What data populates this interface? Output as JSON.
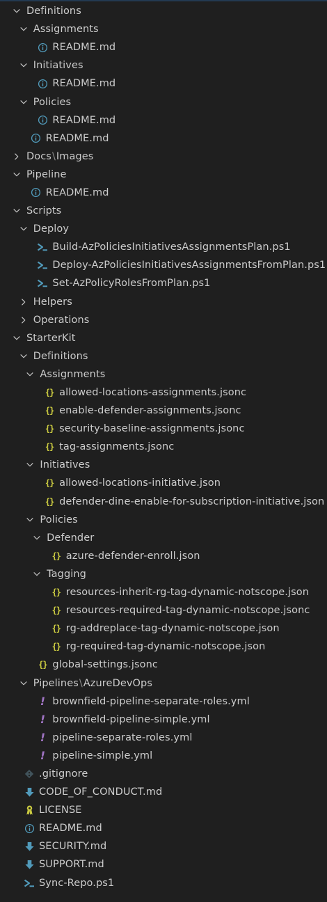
{
  "tree": [
    {
      "type": "folder",
      "depth": 0,
      "expanded": true,
      "label": "Definitions"
    },
    {
      "type": "folder",
      "depth": 1,
      "expanded": true,
      "label": "Assignments"
    },
    {
      "type": "file",
      "depth": 2,
      "icon": "info-icon",
      "label": "README.md"
    },
    {
      "type": "folder",
      "depth": 1,
      "expanded": true,
      "label": "Initiatives"
    },
    {
      "type": "file",
      "depth": 2,
      "icon": "info-icon",
      "label": "README.md"
    },
    {
      "type": "folder",
      "depth": 1,
      "expanded": true,
      "label": "Policies"
    },
    {
      "type": "file",
      "depth": 2,
      "icon": "info-icon",
      "label": "README.md"
    },
    {
      "type": "file",
      "depth": 1,
      "icon": "info-icon",
      "label": "README.md"
    },
    {
      "type": "folder",
      "depth": 0,
      "expanded": false,
      "label": "Docs",
      "label2": "Images"
    },
    {
      "type": "folder",
      "depth": 0,
      "expanded": true,
      "label": "Pipeline"
    },
    {
      "type": "file",
      "depth": 1,
      "icon": "info-icon",
      "label": "README.md"
    },
    {
      "type": "folder",
      "depth": 0,
      "expanded": true,
      "label": "Scripts"
    },
    {
      "type": "folder",
      "depth": 1,
      "expanded": true,
      "label": "Deploy"
    },
    {
      "type": "file",
      "depth": 2,
      "icon": "powershell-icon",
      "label": "Build-AzPoliciesInitiativesAssignmentsPlan.ps1"
    },
    {
      "type": "file",
      "depth": 2,
      "icon": "powershell-icon",
      "label": "Deploy-AzPoliciesInitiativesAssignmentsFromPlan.ps1"
    },
    {
      "type": "file",
      "depth": 2,
      "icon": "powershell-icon",
      "label": "Set-AzPolicyRolesFromPlan.ps1"
    },
    {
      "type": "folder",
      "depth": 1,
      "expanded": false,
      "label": "Helpers"
    },
    {
      "type": "folder",
      "depth": 1,
      "expanded": false,
      "label": "Operations"
    },
    {
      "type": "folder",
      "depth": 0,
      "expanded": true,
      "label": "StarterKit"
    },
    {
      "type": "folder",
      "depth": 1,
      "expanded": true,
      "label": "Definitions"
    },
    {
      "type": "folder",
      "depth": 2,
      "expanded": true,
      "label": "Assignments"
    },
    {
      "type": "file",
      "depth": 3,
      "icon": "json-icon",
      "label": "allowed-locations-assignments.jsonc"
    },
    {
      "type": "file",
      "depth": 3,
      "icon": "json-icon",
      "label": "enable-defender-assignments.jsonc"
    },
    {
      "type": "file",
      "depth": 3,
      "icon": "json-icon",
      "label": "security-baseline-assignments.jsonc"
    },
    {
      "type": "file",
      "depth": 3,
      "icon": "json-icon",
      "label": "tag-assignments.jsonc"
    },
    {
      "type": "folder",
      "depth": 2,
      "expanded": true,
      "label": "Initiatives"
    },
    {
      "type": "file",
      "depth": 3,
      "icon": "json-icon",
      "label": "allowed-locations-initiative.json"
    },
    {
      "type": "file",
      "depth": 3,
      "icon": "json-icon",
      "label": "defender-dine-enable-for-subscription-initiative.json"
    },
    {
      "type": "folder",
      "depth": 2,
      "expanded": true,
      "label": "Policies"
    },
    {
      "type": "folder",
      "depth": 3,
      "expanded": true,
      "label": "Defender"
    },
    {
      "type": "file",
      "depth": 4,
      "icon": "json-icon",
      "label": "azure-defender-enroll.json"
    },
    {
      "type": "folder",
      "depth": 3,
      "expanded": true,
      "label": "Tagging"
    },
    {
      "type": "file",
      "depth": 4,
      "icon": "json-icon",
      "label": "resources-inherit-rg-tag-dynamic-notscope.json"
    },
    {
      "type": "file",
      "depth": 4,
      "icon": "json-icon",
      "label": "resources-required-tag-dynamic-notscope.jsonc"
    },
    {
      "type": "file",
      "depth": 4,
      "icon": "json-icon",
      "label": "rg-addreplace-tag-dynamic-notscope.json"
    },
    {
      "type": "file",
      "depth": 4,
      "icon": "json-icon",
      "label": "rg-required-tag-dynamic-notscope.json"
    },
    {
      "type": "file",
      "depth": 2,
      "icon": "json-icon",
      "label": "global-settings.jsonc"
    },
    {
      "type": "folder",
      "depth": 1,
      "expanded": true,
      "label": "Pipelines",
      "label2": "AzureDevOps"
    },
    {
      "type": "file",
      "depth": 2,
      "icon": "yaml-icon",
      "label": "brownfield-pipeline-separate-roles.yml"
    },
    {
      "type": "file",
      "depth": 2,
      "icon": "yaml-icon",
      "label": "brownfield-pipeline-simple.yml"
    },
    {
      "type": "file",
      "depth": 2,
      "icon": "yaml-icon",
      "label": "pipeline-separate-roles.yml"
    },
    {
      "type": "file",
      "depth": 2,
      "icon": "yaml-icon",
      "label": "pipeline-simple.yml"
    },
    {
      "type": "file",
      "depth": 0,
      "icon": "git-icon",
      "label": ".gitignore"
    },
    {
      "type": "file",
      "depth": 0,
      "icon": "markdown-download-icon",
      "label": "CODE_OF_CONDUCT.md"
    },
    {
      "type": "file",
      "depth": 0,
      "icon": "license-icon",
      "label": "LICENSE"
    },
    {
      "type": "file",
      "depth": 0,
      "icon": "info-icon",
      "label": "README.md"
    },
    {
      "type": "file",
      "depth": 0,
      "icon": "markdown-download-icon",
      "label": "SECURITY.md"
    },
    {
      "type": "file",
      "depth": 0,
      "icon": "markdown-download-icon",
      "label": "SUPPORT.md"
    },
    {
      "type": "file",
      "depth": 0,
      "icon": "powershell-icon",
      "label": "Sync-Repo.ps1"
    }
  ],
  "path_separator": "\\",
  "colors": {
    "background": "#1f1f1f",
    "text": "#cccccc",
    "info": "#519aba",
    "powershell": "#519aba",
    "json": "#cbcb41",
    "yaml": "#a074c4",
    "git": "#41535b",
    "markdown_download": "#519aba",
    "license": "#cbcb41"
  }
}
